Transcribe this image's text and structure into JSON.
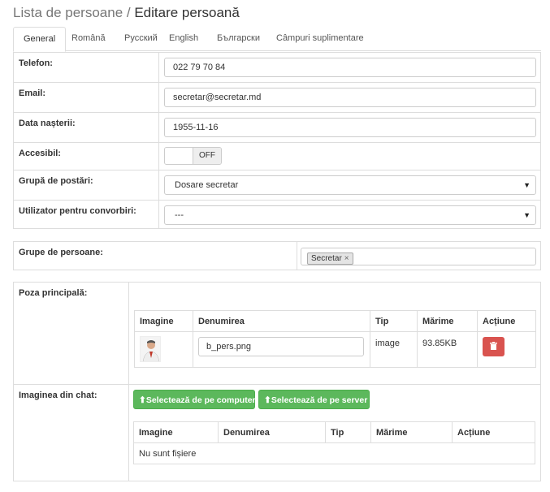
{
  "header": {
    "breadcrumb": "Lista de persoane",
    "separator": " / ",
    "title": "Editare persoană"
  },
  "tabs": [
    {
      "label": "General",
      "active": true
    },
    {
      "label": "Română"
    },
    {
      "label": "Русский"
    },
    {
      "label": "English"
    },
    {
      "label": "Български"
    },
    {
      "label": "Câmpuri suplimentare"
    }
  ],
  "form": {
    "phone": {
      "label": "Telefon:",
      "value": "022 79 70 84"
    },
    "email": {
      "label": "Email:",
      "value": "secretar@secretar.md"
    },
    "birth": {
      "label": "Data nașterii:",
      "value": "1955-11-16"
    },
    "accessible": {
      "label": "Accesibil:",
      "state": "OFF"
    },
    "post_group": {
      "label": "Grupă de postări:",
      "value": "Dosare secretar"
    },
    "chat_user": {
      "label": "Utilizator pentru convorbiri:",
      "value": "---"
    }
  },
  "groups": {
    "label": "Grupe de persoane:",
    "tags": [
      "Secretar"
    ],
    "remove_glyph": "×"
  },
  "main_photo": {
    "label": "Poza principală:",
    "columns": [
      "Imagine",
      "Denumirea",
      "Tip",
      "Mărime",
      "Acțiune"
    ],
    "rows": [
      {
        "name": "b_pers.png",
        "type": "image",
        "size": "93.85KB"
      }
    ],
    "delete_icon": "trash-icon"
  },
  "chat_image": {
    "label": "Imaginea din chat:",
    "btn_computer": "Selectează de pe computer",
    "btn_server": "Selectează de pe server",
    "columns": [
      "Imagine",
      "Denumirea",
      "Tip",
      "Mărime",
      "Acțiune"
    ],
    "empty": "Nu sunt fișiere"
  },
  "colors": {
    "accent_green": "#5cb85c",
    "danger": "#d9534f",
    "border": "#dddddd"
  }
}
